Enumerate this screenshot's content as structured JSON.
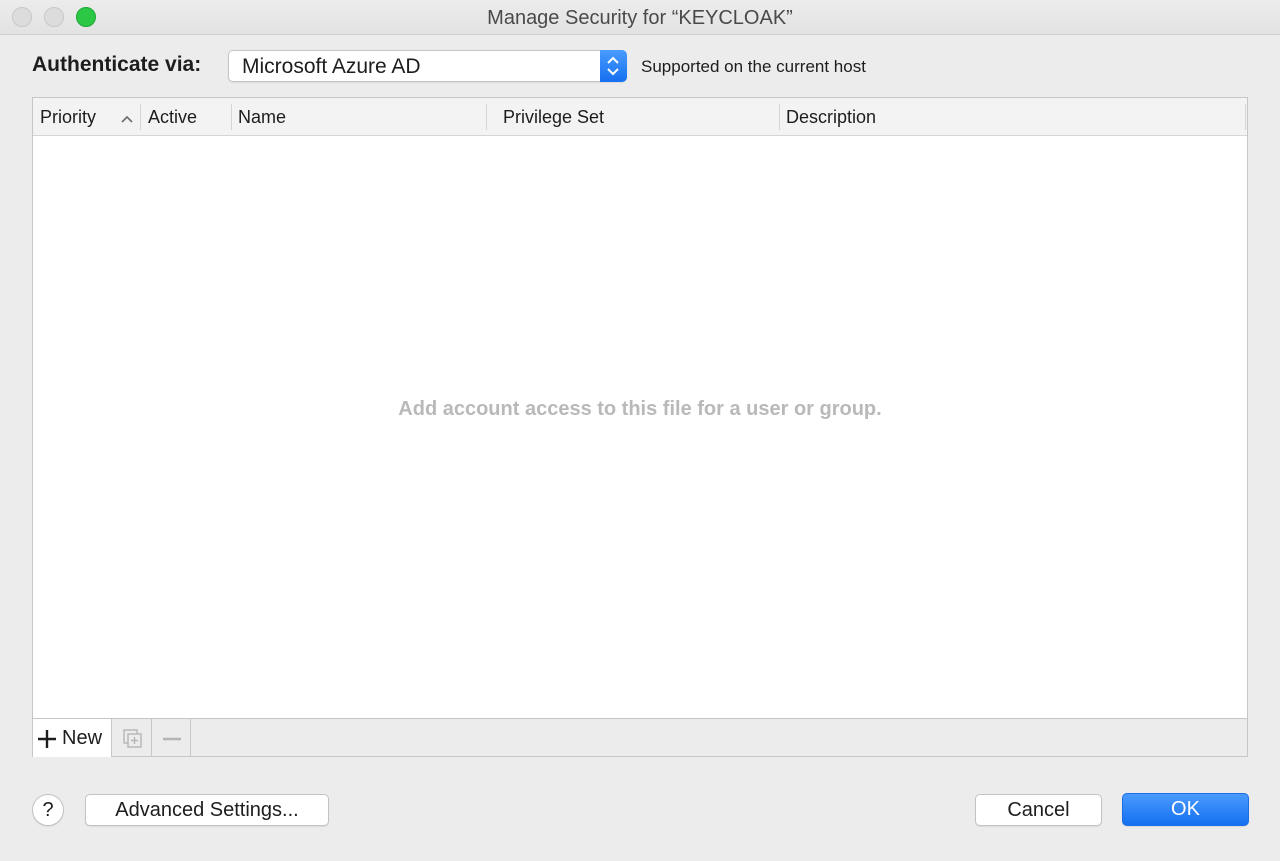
{
  "window": {
    "title": "Manage Security for “KEYCLOAK”"
  },
  "auth": {
    "label": "Authenticate via:",
    "selected": "Microsoft Azure AD",
    "status": "Supported on the current host"
  },
  "table": {
    "columns": [
      "Priority",
      "Active",
      "Name",
      "Privilege Set",
      "Description"
    ],
    "empty_message": "Add account access to this file for a user or group.",
    "rows": []
  },
  "footer": {
    "new_label": "New"
  },
  "buttons": {
    "help": "?",
    "advanced": "Advanced Settings...",
    "cancel": "Cancel",
    "ok": "OK"
  },
  "colors": {
    "accent": "#1570f0",
    "zoom_button": "#2ac845"
  }
}
